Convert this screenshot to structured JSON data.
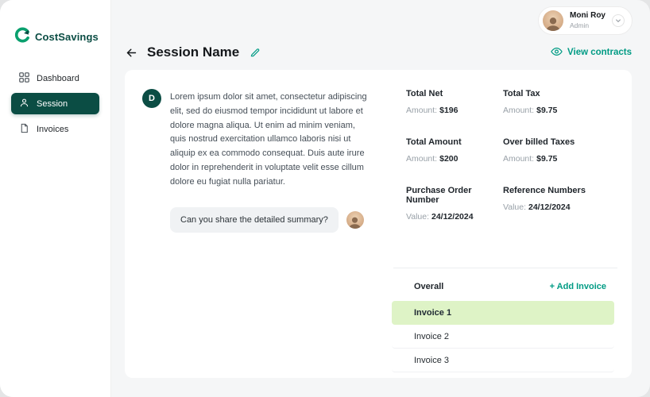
{
  "colors": {
    "brand_dark": "#0b4d44",
    "brand_green": "#0aa06e",
    "accent": "#009b84",
    "highlight": "#def3c6"
  },
  "sidebar": {
    "logo": "CostSavings",
    "items": [
      {
        "label": "Dashboard"
      },
      {
        "label": "Session"
      },
      {
        "label": "Invoices"
      }
    ]
  },
  "header": {
    "user": {
      "name": "Moni Roy",
      "role": "Admin"
    }
  },
  "main": {
    "title": "Session Name",
    "view_contracts": "View contracts",
    "chat": {
      "bot_initial": "D",
      "message": "Lorem ipsum dolor sit amet, consectetur adipiscing elit, sed do eiusmod tempor incididunt ut labore et dolore magna aliqua. Ut enim ad minim veniam, quis nostrud exercitation ullamco laboris nisi ut aliquip ex ea commodo consequat. Duis aute irure dolor in reprehenderit in voluptate velit esse cillum dolore eu fugiat nulla pariatur.",
      "user_question": "Can you share the detailed summary?"
    },
    "summary": {
      "fields": [
        {
          "label": "Total Net",
          "prefix": "Amount:",
          "value": "$196"
        },
        {
          "label": "Total Tax",
          "prefix": "Amount:",
          "value": "$9.75"
        },
        {
          "label": "Total Amount",
          "prefix": "Amount:",
          "value": "$200"
        },
        {
          "label": "Over billed Taxes",
          "prefix": "Amount:",
          "value": "$9.75"
        },
        {
          "label": "Purchase Order Number",
          "prefix": "Value:",
          "value": "24/12/2024"
        },
        {
          "label": "Reference Numbers",
          "prefix": "Value:",
          "value": "24/12/2024"
        }
      ],
      "overall_label": "Overall",
      "add_invoice_label": "+ Add Invoice",
      "invoices": [
        {
          "label": "Invoice 1"
        },
        {
          "label": "Invoice 2"
        },
        {
          "label": "Invoice 3"
        }
      ]
    }
  }
}
